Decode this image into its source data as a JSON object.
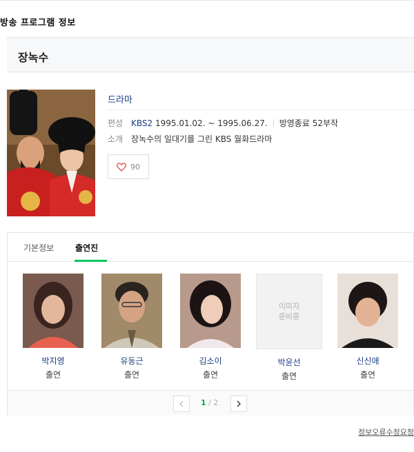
{
  "section_title": "방송 프로그램 정보",
  "program": {
    "title": "장녹수",
    "genre": "드라마",
    "broadcast_label": "편성",
    "channel": "KBS2",
    "dates": "1995.01.02. ~ 1995.06.27.",
    "status": "방영종료 52부작",
    "intro_label": "소개",
    "intro": "장녹수의 일대기를 그린 KBS 월화드라마",
    "likes": "90"
  },
  "tabs": [
    {
      "label": "기본정보",
      "active": false
    },
    {
      "label": "출연진",
      "active": true
    }
  ],
  "cast": [
    {
      "name": "박지영",
      "role": "출연"
    },
    {
      "name": "유동근",
      "role": "출연"
    },
    {
      "name": "김소이",
      "role": "출연"
    },
    {
      "name": "박윤선",
      "role": "출연",
      "placeholder": "이미지\n준비중"
    },
    {
      "name": "신신애",
      "role": "출연"
    }
  ],
  "pager": {
    "current": "1",
    "separator": "/",
    "total": "2"
  },
  "report_link": "정보오류수정요청",
  "colors": {
    "accent": "#03c75a",
    "link": "#1b3c84"
  }
}
